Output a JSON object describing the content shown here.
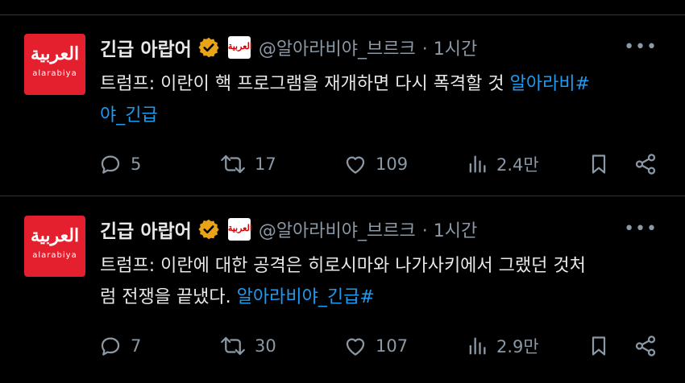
{
  "tweets": [
    {
      "avatar_text": "العربية",
      "avatar_subtext": "alarabiya",
      "affiliate_text": "العربية",
      "name": "긴급 아랍어",
      "handle": "@알아라비야_브르크",
      "time": "· 1시간",
      "text": "트럼프: 이란이 핵 프로그램을 재개하면 다시 폭격할 것 ",
      "hashtag_line1": "알아라비#",
      "hashtag_line2": "야_긴급",
      "replies": "5",
      "retweets": "17",
      "likes": "109",
      "views": "2.4만"
    },
    {
      "avatar_text": "العربية",
      "avatar_subtext": "alarabiya",
      "affiliate_text": "العربية",
      "name": "긴급 아랍어",
      "handle": "@알아라비야_브르크",
      "time": "· 1시간",
      "text_line1": "트럼프: 이란에 대한 공격은 히로시마와 나가사키에서 그랬던 것처",
      "text_line2": "럼 전쟁을 끝냈다. ",
      "hashtag": "알아라비야_긴급#",
      "replies": "7",
      "retweets": "30",
      "likes": "107",
      "views": "2.9만"
    }
  ],
  "more_glyph": "•••",
  "colors": {
    "background": "#000000",
    "text": "#e7e9ea",
    "muted": "#8b98a5",
    "link": "#1d9bf0",
    "badge": "#e8a317",
    "avatar": "#e5202e"
  }
}
